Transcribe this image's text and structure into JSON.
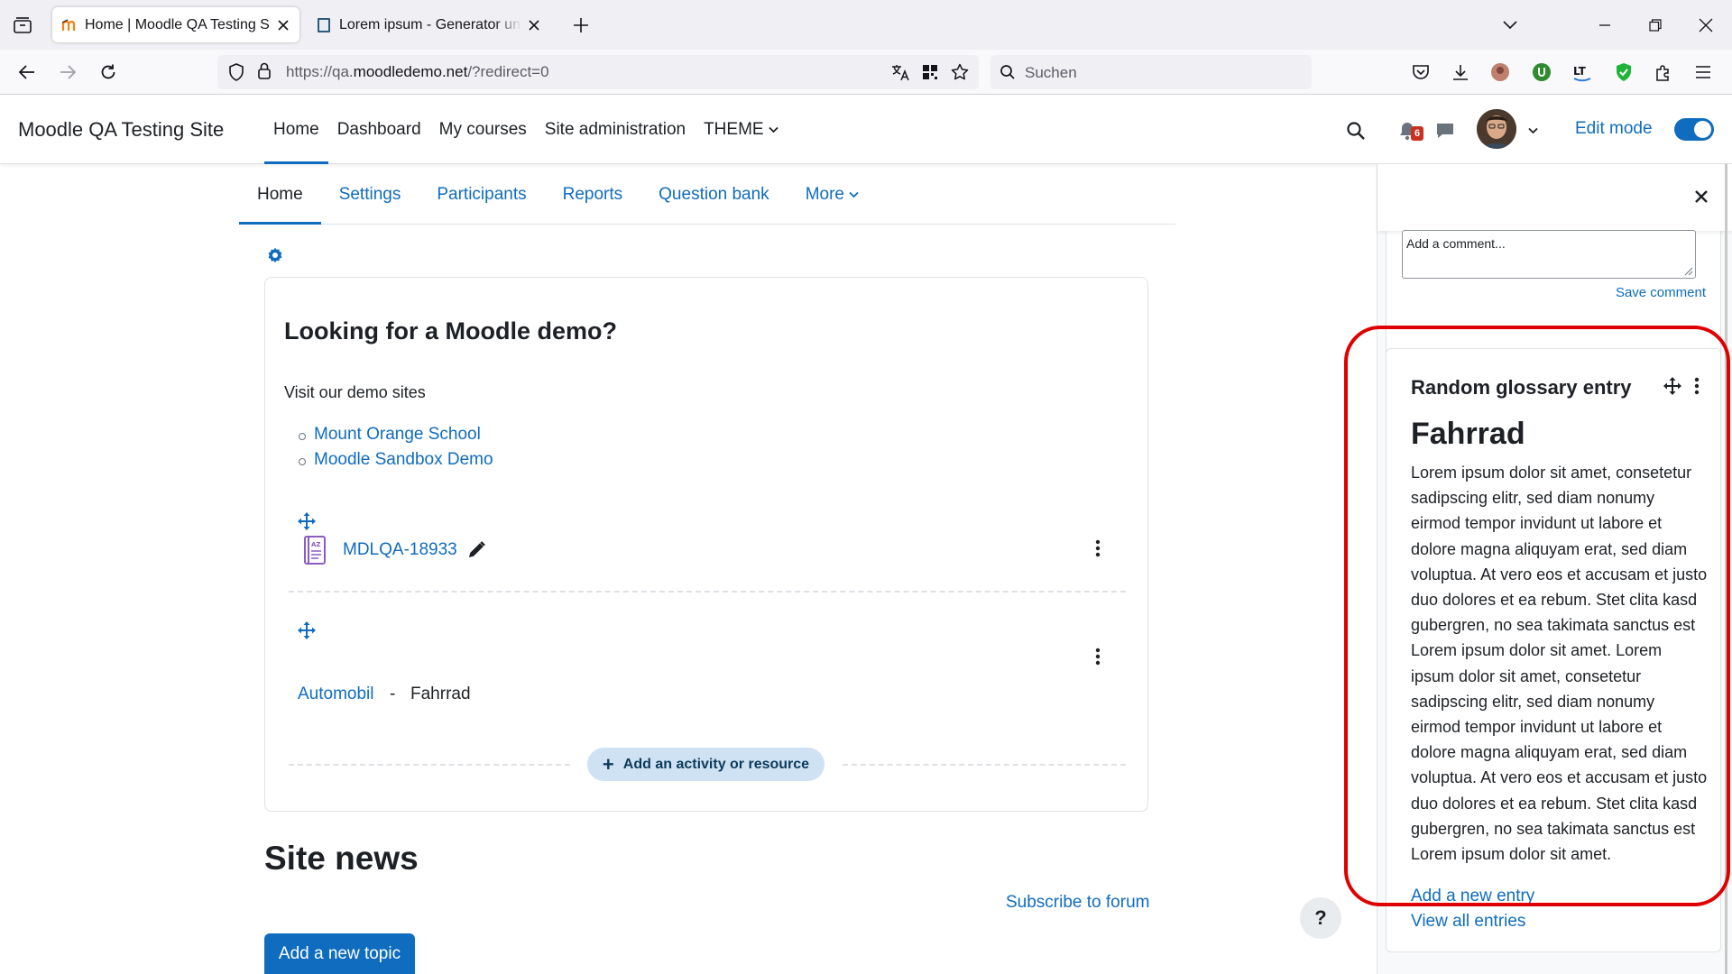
{
  "browser": {
    "tabs": [
      {
        "title": "Home | Moodle QA Testing Site",
        "active": true
      },
      {
        "title": "Lorem ipsum - Generator und Info",
        "active": false
      }
    ],
    "url_prefix": "https://qa.",
    "url_host": "moodledemo.net",
    "url_path": "/?redirect=0",
    "search_placeholder": "Suchen"
  },
  "header": {
    "site_name": "Moodle QA Testing Site",
    "nav": [
      {
        "label": "Home",
        "active": true
      },
      {
        "label": "Dashboard"
      },
      {
        "label": "My courses"
      },
      {
        "label": "Site administration"
      },
      {
        "label": "THEME"
      }
    ],
    "notification_count": "6",
    "edit_mode_label": "Edit mode",
    "edit_mode_on": true
  },
  "secondary_nav": [
    {
      "label": "Home",
      "active": true
    },
    {
      "label": "Settings"
    },
    {
      "label": "Participants"
    },
    {
      "label": "Reports"
    },
    {
      "label": "Question bank"
    },
    {
      "label": "More"
    }
  ],
  "main": {
    "heading": "Looking for a Moodle demo?",
    "intro": "Visit our demo sites",
    "demo_links": [
      "Mount Orange School",
      "Moodle Sandbox Demo"
    ],
    "activity_name": "MDLQA-18933",
    "entries": {
      "first": "Automobil",
      "separator": "-",
      "second": "Fahrrad"
    },
    "add_activity_label": "Add an activity or resource",
    "site_news_heading": "Site news",
    "subscribe_label": "Subscribe to forum",
    "add_topic_label": "Add a new topic",
    "help_label": "?"
  },
  "drawer": {
    "comment_placeholder": "Add a comment...",
    "save_comment_label": "Save comment",
    "glossary": {
      "block_title": "Random glossary entry",
      "concept": "Fahrrad",
      "definition": "Lorem ipsum dolor sit amet, consetetur sadipscing elitr, sed diam nonumy eirmod tempor invidunt ut labore et dolore magna aliquyam erat, sed diam voluptua. At vero eos et accusam et justo duo dolores et ea rebum. Stet clita kasd gubergren, no sea takimata sanctus est Lorem ipsum dolor sit amet. Lorem ipsum dolor sit amet, consetetur sadipscing elitr, sed diam nonumy eirmod tempor invidunt ut labore et dolore magna aliquyam erat, sed diam voluptua. At vero eos et accusam et justo duo dolores et ea rebum. Stet clita kasd gubergren, no sea takimata sanctus est Lorem ipsum dolor sit amet.",
      "add_entry_label": "Add a new entry",
      "view_all_label": "View all entries"
    }
  },
  "colors": {
    "brand": "#0f6cbf",
    "highlight": "#e00000",
    "badge": "#ca3120"
  }
}
